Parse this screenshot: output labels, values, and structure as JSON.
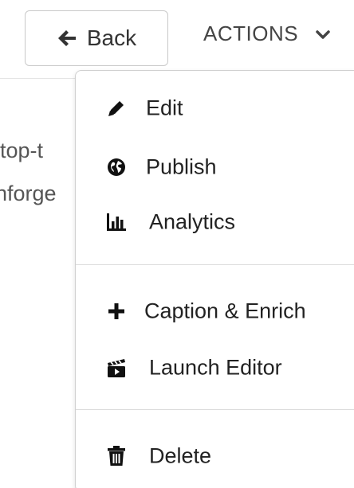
{
  "header": {
    "back_label": "Back",
    "actions_label": "ACTIONS"
  },
  "background": {
    "line1": "top-t",
    "line2": "nforge"
  },
  "menu": {
    "items": [
      {
        "label": "Edit",
        "icon": "pencil-icon"
      },
      {
        "label": "Publish",
        "icon": "globe-icon"
      },
      {
        "label": "Analytics",
        "icon": "bar-chart-icon"
      },
      {
        "label": "Caption & Enrich",
        "icon": "plus-icon"
      },
      {
        "label": "Launch Editor",
        "icon": "clapperboard-icon"
      },
      {
        "label": "Delete",
        "icon": "trash-icon"
      }
    ]
  }
}
